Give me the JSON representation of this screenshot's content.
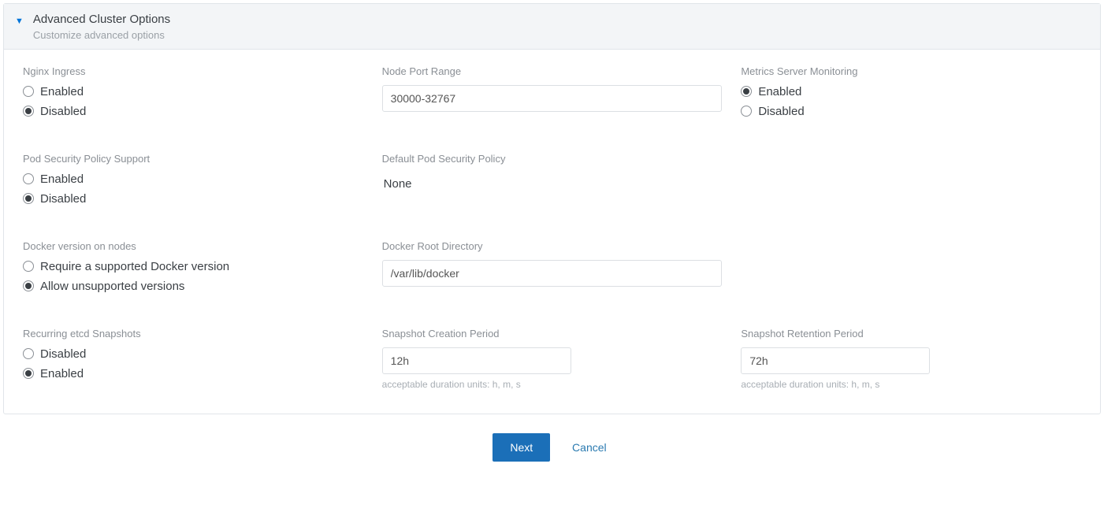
{
  "header": {
    "title": "Advanced Cluster Options",
    "subtitle": "Customize advanced options"
  },
  "nginx_ingress": {
    "label": "Nginx Ingress",
    "option_enabled": "Enabled",
    "option_disabled": "Disabled",
    "selected": "disabled"
  },
  "node_port_range": {
    "label": "Node Port Range",
    "value": "30000-32767"
  },
  "metrics_server": {
    "label": "Metrics Server Monitoring",
    "option_enabled": "Enabled",
    "option_disabled": "Disabled",
    "selected": "enabled"
  },
  "pod_security": {
    "label": "Pod Security Policy Support",
    "option_enabled": "Enabled",
    "option_disabled": "Disabled",
    "selected": "disabled"
  },
  "default_pod_security": {
    "label": "Default Pod Security Policy",
    "value": "None"
  },
  "docker_version": {
    "label": "Docker version on nodes",
    "option_required": "Require a supported Docker version",
    "option_allow": "Allow unsupported versions",
    "selected": "allow"
  },
  "docker_root": {
    "label": "Docker Root Directory",
    "value": "/var/lib/docker"
  },
  "etcd_snapshots": {
    "label": "Recurring etcd Snapshots",
    "option_disabled": "Disabled",
    "option_enabled": "Enabled",
    "selected": "enabled"
  },
  "snapshot_creation": {
    "label": "Snapshot Creation Period",
    "value": "12h",
    "hint": "acceptable duration units: h, m, s"
  },
  "snapshot_retention": {
    "label": "Snapshot Retention Period",
    "value": "72h",
    "hint": "acceptable duration units: h, m, s"
  },
  "footer": {
    "next": "Next",
    "cancel": "Cancel"
  }
}
